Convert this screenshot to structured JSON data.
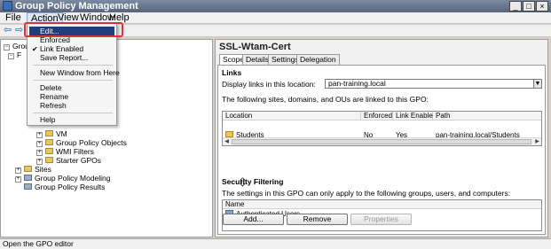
{
  "window": {
    "title": "Group Policy Management",
    "controls": [
      "_",
      "□",
      "×"
    ]
  },
  "menubar": {
    "items": [
      "File",
      "Action",
      "View",
      "Window",
      "Help"
    ],
    "active": "Action"
  },
  "toolbar": {
    "back": "⇦",
    "forward": "⇨"
  },
  "context_menu": {
    "items": [
      {
        "label": "Edit...",
        "highlighted": true
      },
      {
        "label": "Enforced"
      },
      {
        "label": "Link Enabled",
        "checked": true
      },
      {
        "label": "Save Report..."
      },
      {
        "label": "New Window from Here"
      },
      {
        "label": "Delete"
      },
      {
        "label": "Rename"
      },
      {
        "label": "Refresh"
      },
      {
        "label": "Help"
      }
    ],
    "check_mark": "✔"
  },
  "tree": {
    "partial_top": [
      "Grou",
      "F"
    ],
    "items": [
      {
        "label": "VM",
        "level": 3
      },
      {
        "label": "Group Policy Objects",
        "level": 3
      },
      {
        "label": "WMI Filters",
        "level": 3
      },
      {
        "label": "Starter GPOs",
        "level": 3
      },
      {
        "label": "Sites",
        "level": 1
      },
      {
        "label": "Group Policy Modeling",
        "level": 1
      },
      {
        "label": "Group Policy Results",
        "level": 1
      }
    ]
  },
  "details": {
    "title": "SSL-Wtam-Cert",
    "tabs": [
      "Scope",
      "Details",
      "Settings",
      "Delegation"
    ],
    "selected_tab": "Scope",
    "links": {
      "heading": "Links",
      "display_label": "Display links in this location:",
      "location_value": "pan-training.local",
      "description": "The following sites, domains, and OUs are linked to this GPO:",
      "columns": [
        "Location",
        "Enforced",
        "Link Enabled",
        "Path"
      ],
      "rows": [
        {
          "location": "Students",
          "enforced": "No",
          "link_enabled": "Yes",
          "path": "pan-training.local/Students"
        }
      ]
    },
    "security": {
      "heading": "Security Filtering",
      "description": "The settings in this GPO can only apply to the following groups, users, and computers:",
      "column": "Name",
      "rows": [
        "Authenticated Users"
      ],
      "buttons": {
        "add": "Add...",
        "remove": "Remove",
        "properties": "Properties"
      }
    }
  },
  "status_text": "Open the GPO editor",
  "colors": {
    "highlight": "#1f3d7a",
    "callout": "#e0303a"
  }
}
